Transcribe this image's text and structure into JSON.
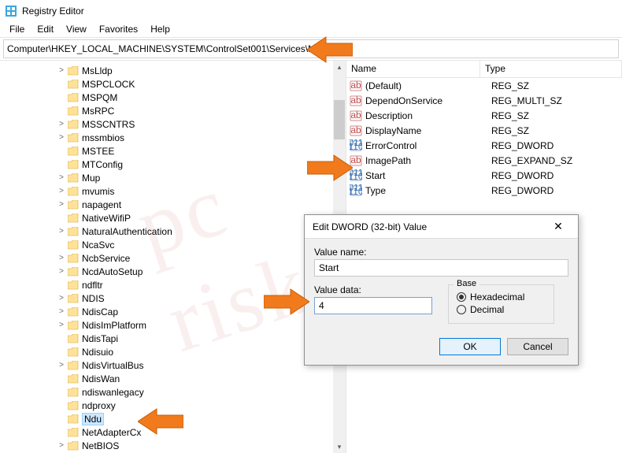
{
  "window": {
    "title": "Registry Editor"
  },
  "menu": {
    "file": "File",
    "edit": "Edit",
    "view": "View",
    "favorites": "Favorites",
    "help": "Help"
  },
  "address": "Computer\\HKEY_LOCAL_MACHINE\\SYSTEM\\ControlSet001\\Services\\Nd",
  "tree_items": [
    {
      "label": "MsLldp",
      "expand": ">"
    },
    {
      "label": "MSPCLOCK",
      "expand": ""
    },
    {
      "label": "MSPQM",
      "expand": ""
    },
    {
      "label": "MsRPC",
      "expand": ""
    },
    {
      "label": "MSSCNTRS",
      "expand": ">"
    },
    {
      "label": "mssmbios",
      "expand": ">"
    },
    {
      "label": "MSTEE",
      "expand": ""
    },
    {
      "label": "MTConfig",
      "expand": ""
    },
    {
      "label": "Mup",
      "expand": ">"
    },
    {
      "label": "mvumis",
      "expand": ">"
    },
    {
      "label": "napagent",
      "expand": ">"
    },
    {
      "label": "NativeWifiP",
      "expand": ""
    },
    {
      "label": "NaturalAuthentication",
      "expand": ">"
    },
    {
      "label": "NcaSvc",
      "expand": ""
    },
    {
      "label": "NcbService",
      "expand": ">"
    },
    {
      "label": "NcdAutoSetup",
      "expand": ">"
    },
    {
      "label": "ndfltr",
      "expand": ""
    },
    {
      "label": "NDIS",
      "expand": ">"
    },
    {
      "label": "NdisCap",
      "expand": ">"
    },
    {
      "label": "NdisImPlatform",
      "expand": ">"
    },
    {
      "label": "NdisTapi",
      "expand": ""
    },
    {
      "label": "Ndisuio",
      "expand": ""
    },
    {
      "label": "NdisVirtualBus",
      "expand": ">"
    },
    {
      "label": "NdisWan",
      "expand": ""
    },
    {
      "label": "ndiswanlegacy",
      "expand": ""
    },
    {
      "label": "ndproxy",
      "expand": ""
    },
    {
      "label": "Ndu",
      "expand": "",
      "selected": true
    },
    {
      "label": "NetAdapterCx",
      "expand": ""
    },
    {
      "label": "NetBIOS",
      "expand": ">"
    }
  ],
  "list": {
    "col_name": "Name",
    "col_type": "Type",
    "rows": [
      {
        "icon": "sz",
        "name": "(Default)",
        "type": "REG_SZ"
      },
      {
        "icon": "sz",
        "name": "DependOnService",
        "type": "REG_MULTI_SZ"
      },
      {
        "icon": "sz",
        "name": "Description",
        "type": "REG_SZ"
      },
      {
        "icon": "sz",
        "name": "DisplayName",
        "type": "REG_SZ"
      },
      {
        "icon": "dw",
        "name": "ErrorControl",
        "type": "REG_DWORD"
      },
      {
        "icon": "sz",
        "name": "ImagePath",
        "type": "REG_EXPAND_SZ"
      },
      {
        "icon": "dw",
        "name": "Start",
        "type": "REG_DWORD"
      },
      {
        "icon": "dw",
        "name": "Type",
        "type": "REG_DWORD"
      }
    ]
  },
  "dialog": {
    "title": "Edit DWORD (32-bit) Value",
    "value_name_label": "Value name:",
    "value_name": "Start",
    "value_data_label": "Value data:",
    "value_data": "4",
    "base_label": "Base",
    "hex": "Hexadecimal",
    "dec": "Decimal",
    "ok": "OK",
    "cancel": "Cancel"
  },
  "watermark": "pc risk.com"
}
